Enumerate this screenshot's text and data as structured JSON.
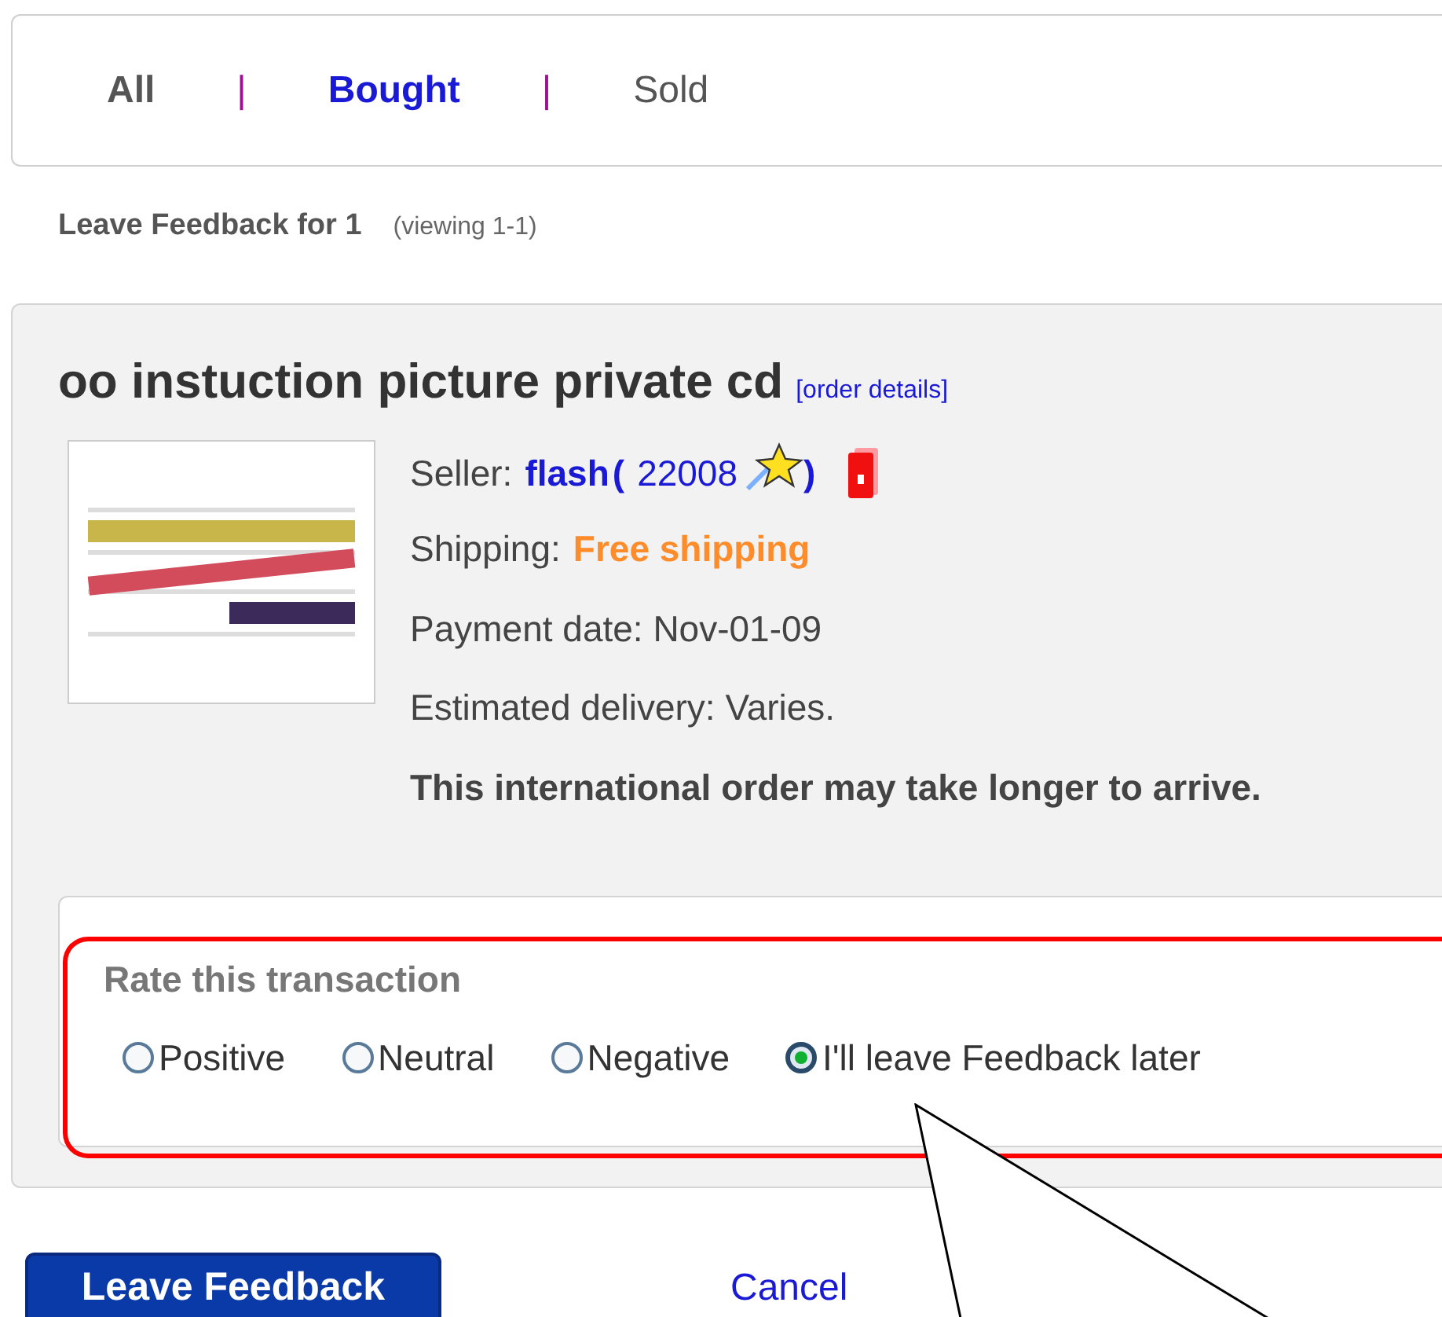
{
  "tabs": [
    {
      "kind": "tab",
      "label": "All",
      "selected": false,
      "bold": true
    },
    {
      "kind": "separator",
      "label": "|"
    },
    {
      "kind": "tab",
      "label": "Bought",
      "selected": true,
      "bold": true
    },
    {
      "kind": "separator",
      "label": "|"
    },
    {
      "kind": "tab",
      "label": "Sold",
      "selected": false,
      "bold": false
    }
  ],
  "heading": {
    "title": "Leave Feedback for 1",
    "count": "(viewing 1-1)"
  },
  "item": {
    "title": "oo instuction picture private cd",
    "details_link": "[order details]",
    "seller": {
      "label": "Seller:",
      "name": "flash",
      "open": "(",
      "score": "22008",
      "close": ")"
    },
    "shipping": {
      "label": "Shipping:",
      "value": "Free shipping"
    },
    "payment": "Payment date: Nov-01-09",
    "delivery": "Estimated delivery: Varies.",
    "note": "This international order may take longer to arrive."
  },
  "rating": {
    "title": "Rate this transaction",
    "options": [
      {
        "label": "Positive",
        "selected": false
      },
      {
        "label": "Neutral",
        "selected": false
      },
      {
        "label": "Negative",
        "selected": false
      },
      {
        "label": "I'll leave Feedback later",
        "selected": true
      }
    ]
  },
  "buttons": {
    "submit": "Leave Feedback",
    "cancel": "Cancel"
  }
}
